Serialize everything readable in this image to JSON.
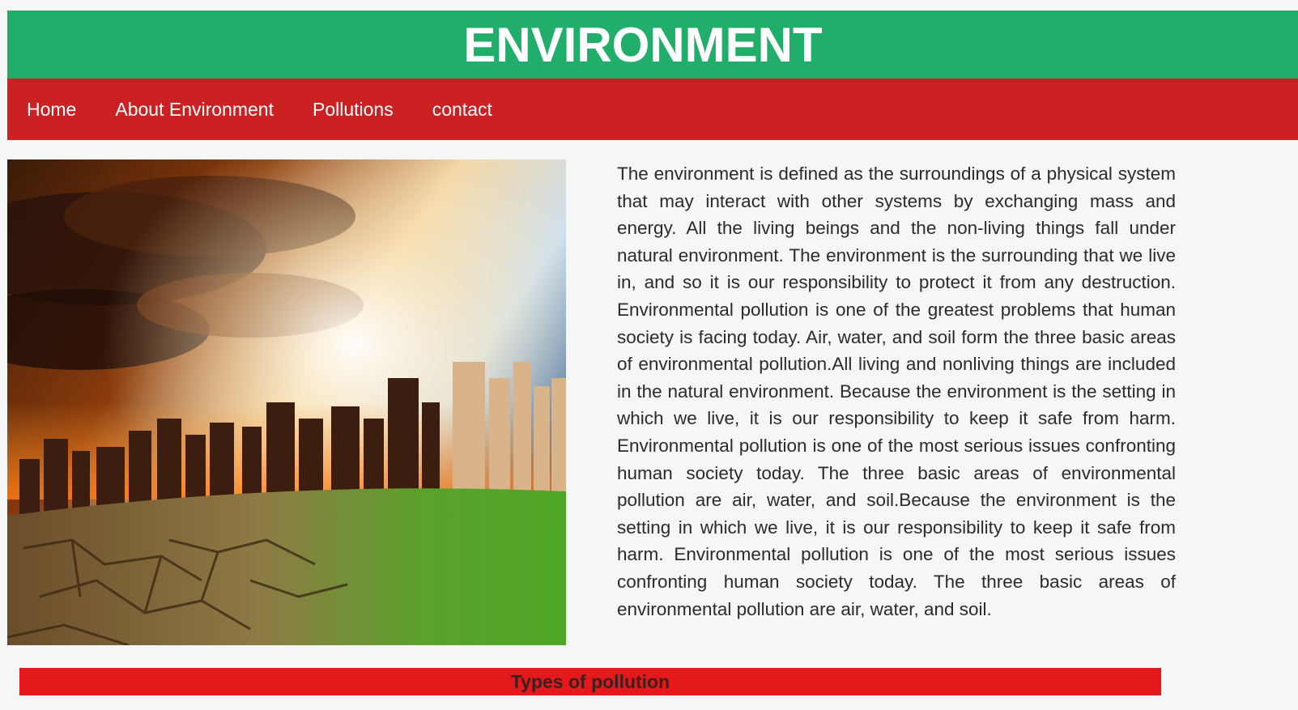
{
  "header": {
    "title": "ENVIRONMENT"
  },
  "nav": {
    "items": [
      {
        "label": "Home"
      },
      {
        "label": "About Environment"
      },
      {
        "label": "Pollutions"
      },
      {
        "label": "contact"
      }
    ]
  },
  "hero_image": {
    "description_icon": "city-cracked-earth-image"
  },
  "article": {
    "text": "The environment is defined as the surroundings of a physical system that may interact with other systems by exchanging mass and energy. All the living beings and the non-living things fall under natural environment. The environment is the surrounding that we live in, and so it is our responsibility to protect it from any destruction. Environmental pollution is one of the greatest problems that human society is facing today. Air, water, and soil form the three basic areas of environmental pollution.All living and nonliving things are included in the natural environment. Because the environment is the setting in which we live, it is our responsibility to keep it safe from harm. Environmental pollution is one of the most serious issues confronting human society today. The three basic areas of environmental pollution are air, water, and soil.Because the environment is the setting in which we live, it is our responsibility to keep it safe from harm. Environmental pollution is one of the most serious issues confronting human society today. The three basic areas of environmental pollution are air, water, and soil."
  },
  "section": {
    "title": "Types of pollution"
  },
  "colors": {
    "header_bg": "#21ad6a",
    "nav_bg": "#cc2122",
    "section_bar_bg": "#e5191b",
    "page_bg": "#f5f6f6"
  }
}
